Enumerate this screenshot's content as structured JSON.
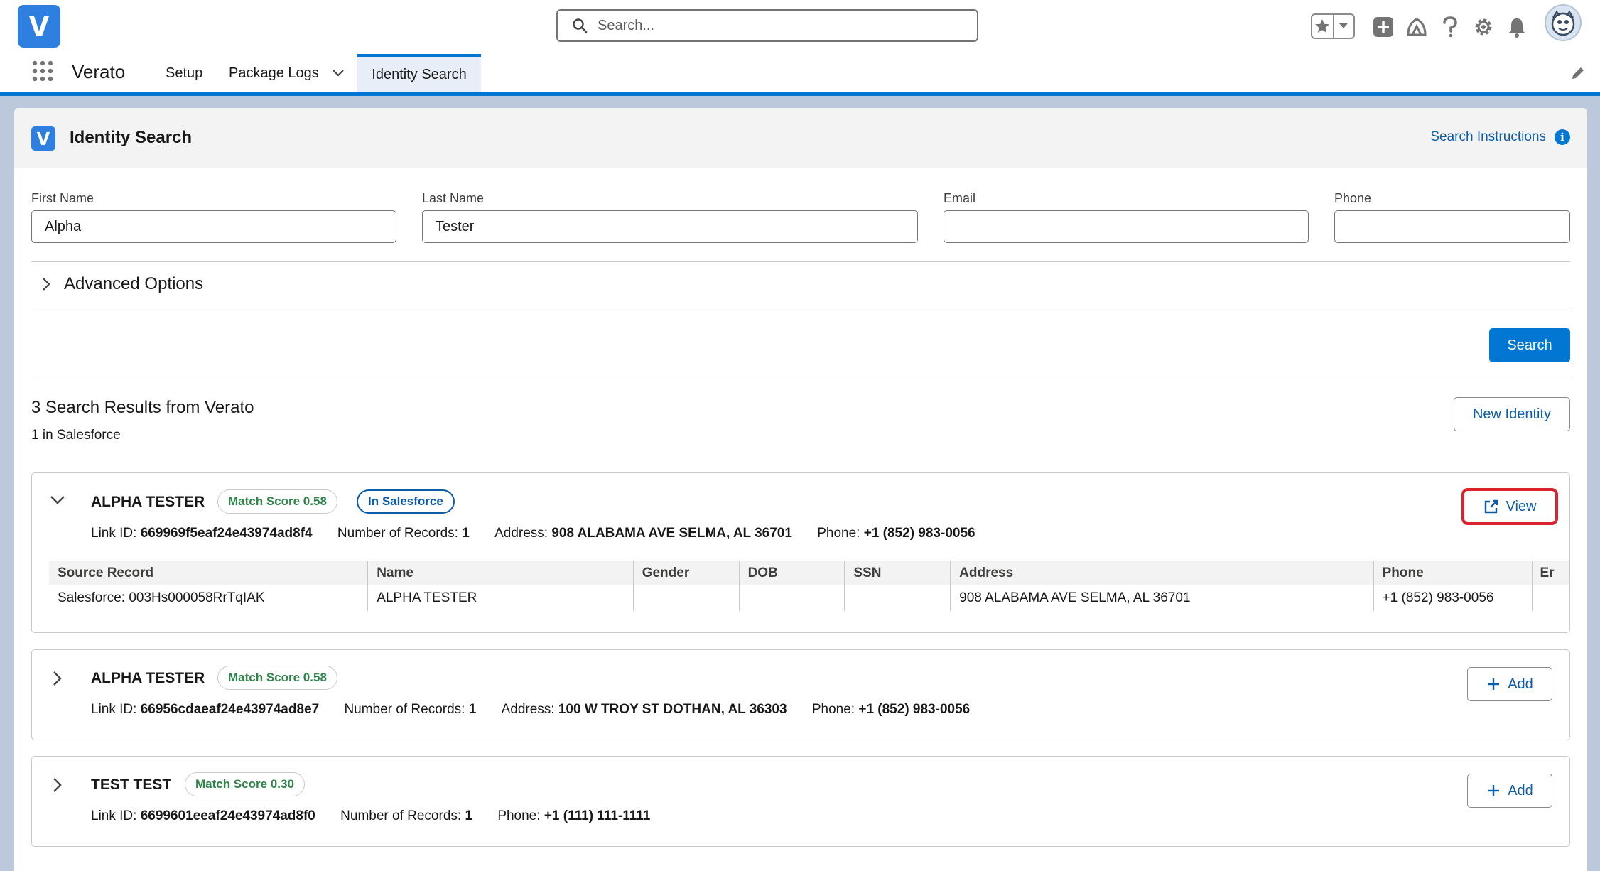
{
  "header": {
    "search_placeholder": "Search..."
  },
  "nav": {
    "app_name": "Verato",
    "tabs": [
      {
        "label": "Setup"
      },
      {
        "label": "Package Logs"
      },
      {
        "label": "Identity Search"
      }
    ]
  },
  "card": {
    "title": "Identity Search",
    "instructions_link": "Search Instructions",
    "info_glyph": "i"
  },
  "form": {
    "first_name": {
      "label": "First Name",
      "value": "Alpha"
    },
    "last_name": {
      "label": "Last Name",
      "value": "Tester"
    },
    "email": {
      "label": "Email",
      "value": ""
    },
    "phone": {
      "label": "Phone",
      "value": ""
    },
    "advanced_options": "Advanced Options",
    "search_button": "Search"
  },
  "results": {
    "title": "3 Search Results from Verato",
    "subtitle": "1 in Salesforce",
    "new_identity_button": "New Identity",
    "items": [
      {
        "name": "ALPHA TESTER",
        "score": "Match Score 0.58",
        "sf_badge": "In Salesforce",
        "link_label": "Link ID:",
        "link_id": "669969f5eaf24e43974ad8f4",
        "records_label": "Number of Records:",
        "records": "1",
        "address_label": "Address:",
        "address": "908 ALABAMA AVE SELMA, AL 36701",
        "phone_label": "Phone:",
        "phone": "+1 (852) 983-0056",
        "action": "View",
        "table": {
          "headers": [
            "Source Record",
            "Name",
            "Gender",
            "DOB",
            "SSN",
            "Address",
            "Phone",
            "Er"
          ],
          "rows": [
            [
              "Salesforce: 003Hs000058RrTqIAK",
              "ALPHA TESTER",
              "",
              "",
              "",
              "908 ALABAMA AVE SELMA, AL 36701",
              "+1 (852) 983-0056",
              ""
            ]
          ]
        }
      },
      {
        "name": "ALPHA TESTER",
        "score": "Match Score 0.58",
        "link_label": "Link ID:",
        "link_id": "66956cdaeaf24e43974ad8e7",
        "records_label": "Number of Records:",
        "records": "1",
        "address_label": "Address:",
        "address": "100 W TROY ST DOTHAN, AL 36303",
        "phone_label": "Phone:",
        "phone": "+1 (852) 983-0056",
        "action": "Add"
      },
      {
        "name": "TEST TEST",
        "score": "Match Score 0.30",
        "link_label": "Link ID:",
        "link_id": "6699601eeaf24e43974ad8f0",
        "records_label": "Number of Records:",
        "records": "1",
        "phone_label": "Phone:",
        "phone": "+1 (111) 111-1111",
        "action": "Add"
      }
    ]
  },
  "colors": {
    "brand": "#0176d3",
    "link": "#0b5cab",
    "score_text": "#2e844a",
    "highlight": "#d9232e"
  },
  "icons": [
    "verato-logo-icon",
    "search-icon",
    "star-icon",
    "caret-down-icon",
    "add-icon",
    "trailhead-icon",
    "help-icon",
    "gear-icon",
    "bell-icon",
    "avatar",
    "app-launcher-icon",
    "chevron-down-icon",
    "pencil-icon",
    "info-icon",
    "chevron-right-icon",
    "new-window-icon",
    "plus-icon"
  ]
}
